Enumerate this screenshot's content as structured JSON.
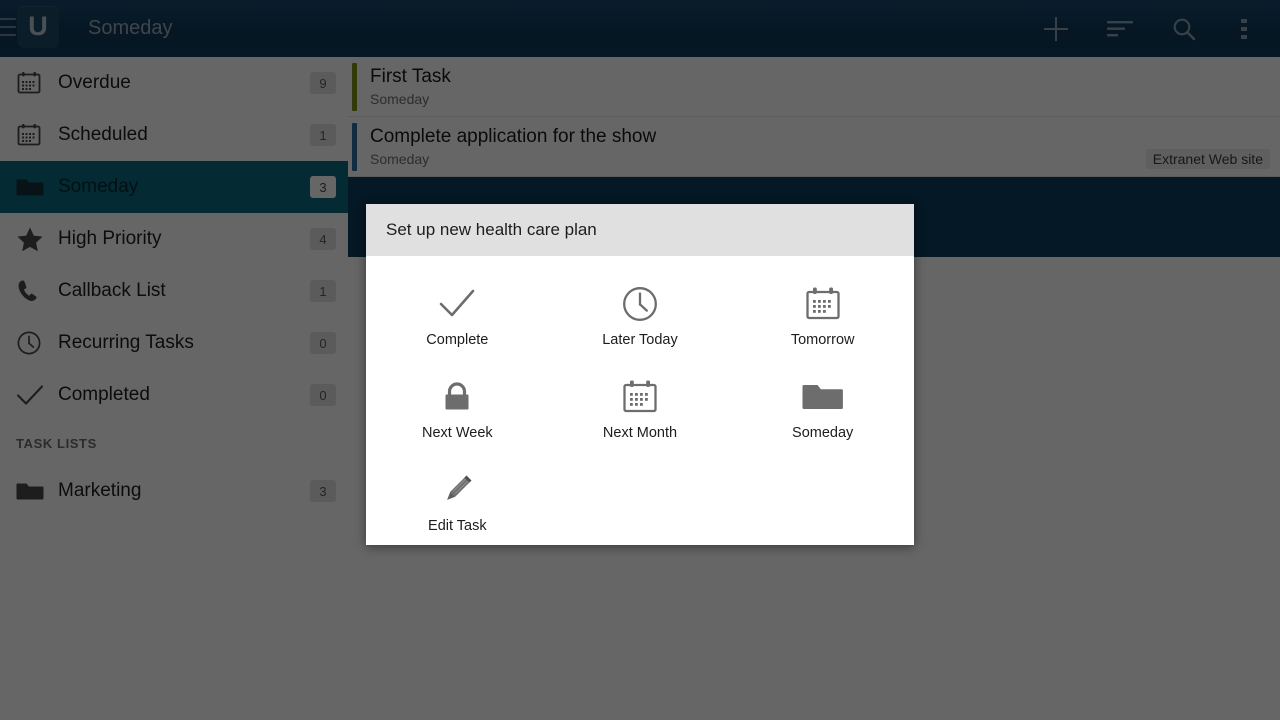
{
  "app": {
    "logo_letter": "U",
    "title": "Someday",
    "accent_navy": "#123F5F",
    "accent_teal": "#0b6a80",
    "selected_row_navy": "#0b3c5c"
  },
  "actionbar": {
    "menu_icon": "hamburger-icon",
    "actions": [
      {
        "name": "add-task-button",
        "icon": "plus-icon",
        "label": "Add"
      },
      {
        "name": "sort-button",
        "icon": "sort-icon",
        "label": "Sort"
      },
      {
        "name": "search-button",
        "icon": "search-icon",
        "label": "Search"
      },
      {
        "name": "overflow-menu-button",
        "icon": "more-vertical-icon",
        "label": "More options"
      }
    ]
  },
  "sidebar": {
    "items": [
      {
        "label": "Overdue",
        "badge": "9",
        "icon": "calendar-icon",
        "selected": false
      },
      {
        "label": "Scheduled",
        "badge": "1",
        "icon": "calendar-icon",
        "selected": false
      },
      {
        "label": "Someday",
        "badge": "3",
        "icon": "folder-icon",
        "selected": true
      },
      {
        "label": "High Priority",
        "badge": "4",
        "icon": "star-icon",
        "selected": false
      },
      {
        "label": "Callback List",
        "badge": "1",
        "icon": "phone-icon",
        "selected": false
      },
      {
        "label": "Recurring Tasks",
        "badge": "0",
        "icon": "clock-icon",
        "selected": false
      },
      {
        "label": "Completed",
        "badge": "0",
        "icon": "check-icon",
        "selected": false
      }
    ],
    "section_header": "TASK LISTS",
    "lists": [
      {
        "label": "Marketing",
        "badge": "3",
        "icon": "folder-icon"
      }
    ]
  },
  "tasks": [
    {
      "title": "First Task",
      "subtitle": "Someday",
      "bar_color": "#7f8f16",
      "tag": "",
      "selected": false
    },
    {
      "title": "Complete application for the show",
      "subtitle": "Someday",
      "bar_color": "#2b6ca3",
      "tag": "Extranet Web site",
      "selected": false
    },
    {
      "title": "",
      "subtitle": "",
      "bar_color": "#0b3c5c",
      "tag": "",
      "selected": true
    }
  ],
  "dialog": {
    "title": "Set up new health care plan",
    "options": [
      {
        "label": "Complete",
        "icon": "check-icon"
      },
      {
        "label": "Later Today",
        "icon": "clock-icon"
      },
      {
        "label": "Tomorrow",
        "icon": "calendar-icon"
      },
      {
        "label": "Next Week",
        "icon": "lock-icon"
      },
      {
        "label": "Next Month",
        "icon": "calendar-icon"
      },
      {
        "label": "Someday",
        "icon": "folder-icon"
      },
      {
        "label": "Edit Task",
        "icon": "pencil-icon"
      }
    ]
  }
}
